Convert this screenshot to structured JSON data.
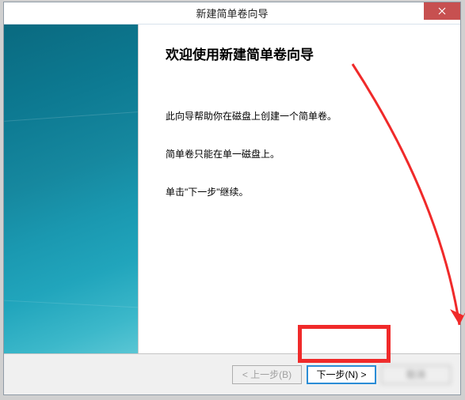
{
  "titlebar": {
    "title": "新建简单卷向导"
  },
  "main": {
    "heading": "欢迎使用新建简单卷向导",
    "line1": "此向导帮助你在磁盘上创建一个简单卷。",
    "line2": "简单卷只能在单一磁盘上。",
    "line3": "单击\"下一步\"继续。"
  },
  "footer": {
    "back_label": "< 上一步(B)",
    "next_label": "下一步(N) >",
    "cancel_label": "取消"
  }
}
